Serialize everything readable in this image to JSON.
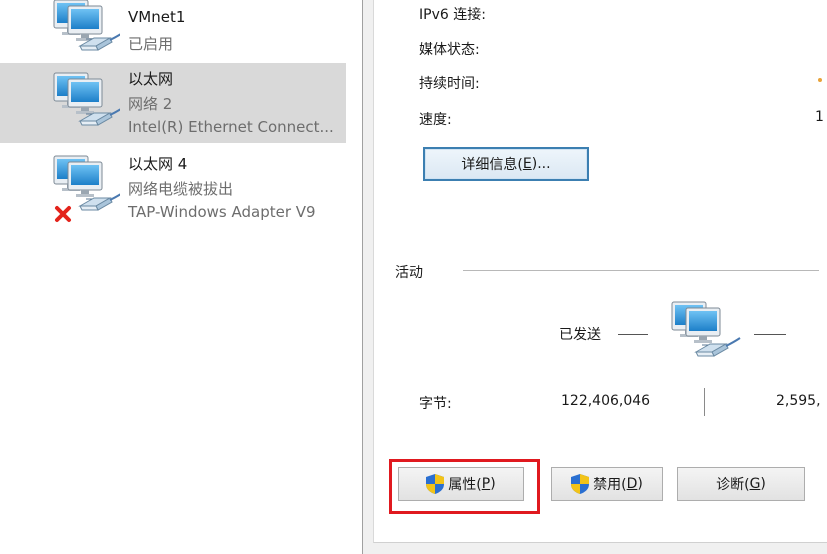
{
  "adapters": [
    {
      "name": "VMnet1",
      "status": "已启用",
      "device": "",
      "selected": false,
      "disconnected": false
    },
    {
      "name": "以太网",
      "status": "网络 2",
      "device": "Intel(R) Ethernet Connect...",
      "selected": true,
      "disconnected": false
    },
    {
      "name": "以太网 4",
      "status": "网络电缆被拔出",
      "device": "TAP-Windows Adapter V9",
      "selected": false,
      "disconnected": true
    }
  ],
  "dialog": {
    "fields": [
      {
        "label": "IPv6 连接:",
        "value": ""
      },
      {
        "label": "媒体状态:",
        "value": ""
      },
      {
        "label": "持续时间:",
        "value": ""
      },
      {
        "label": "速度:",
        "value": "1"
      }
    ],
    "details_button": {
      "text": "详细信息(",
      "key": "E",
      "tail": ")..."
    },
    "activity": {
      "title": "活动",
      "sent_label": "已发送",
      "bytes_label": "字节:",
      "bytes_sent": "122,406,046",
      "bytes_received": "2,595,"
    },
    "buttons": [
      {
        "text": "属性(",
        "key": "P",
        "tail": ")",
        "shield": true
      },
      {
        "text": "禁用(",
        "key": "D",
        "tail": ")",
        "shield": true
      },
      {
        "text": "诊断(",
        "key": "G",
        "tail": ")",
        "shield": false
      }
    ]
  },
  "colors": {
    "selection": "#d9d9d9",
    "highlight": "#e0191f",
    "focus_border": "#3c7fb1",
    "shield_blue": "#2a6fd1",
    "shield_yellow": "#f2c318",
    "error_red": "#e3231b"
  },
  "icons": [
    "network-adapter-icon",
    "network-cable-icon",
    "disconnected-x-icon",
    "shield-icon",
    "network-activity-icon"
  ]
}
